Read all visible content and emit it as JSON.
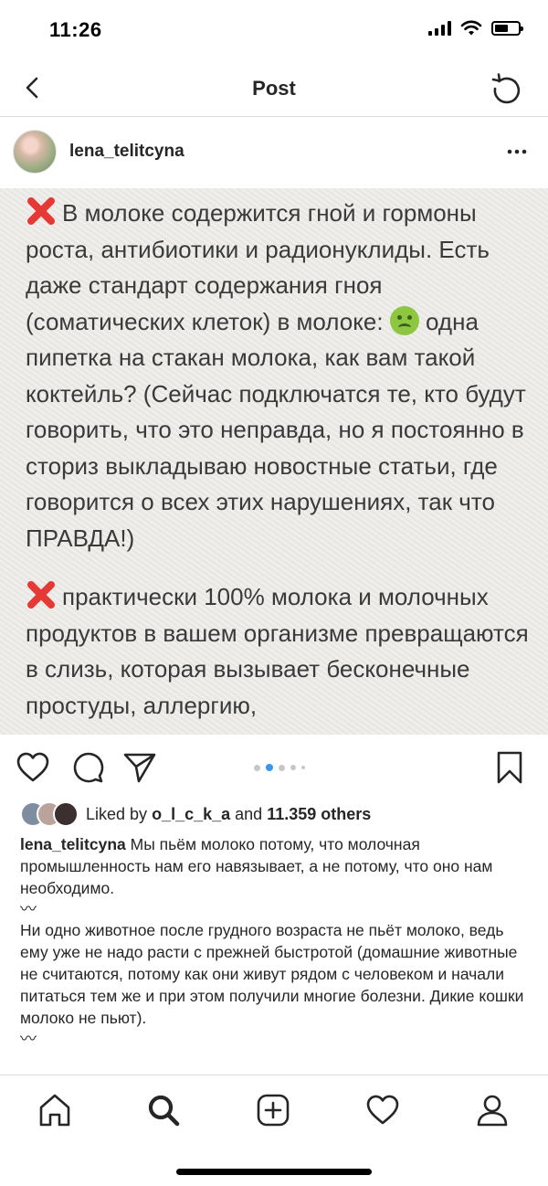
{
  "status_bar": {
    "time": "11:26"
  },
  "nav": {
    "title": "Post"
  },
  "post": {
    "username": "lena_telitcyna",
    "image_text": {
      "p1_text": "В молоке содержится гной и гормоны роста, антибиотики и радионуклиды. Есть даже стандарт содержания гноя (соматических клеток) в молоке: ",
      "p1_text_after_emoji": " одна пипетка на стакан молока, как вам такой коктейль? (Сейчас подключатся те, кто будут говорить, что это неправда, но я постоянно в сториз выкладываю новостные статьи, где говорится о всех этих нарушениях, так что ПРАВДА!)",
      "p2_text": "практически 100% молока и молочных продуктов в вашем организме превращаются в слизь, которая вызывает бесконечные простуды, аллергию,"
    },
    "carousel": {
      "count": 5,
      "active": 1
    },
    "likes": {
      "prefix": "Liked by",
      "user": "o_l_c_k_a",
      "joiner": "and",
      "others": "11.359 others"
    },
    "caption": {
      "username": "lena_telitcyna",
      "text1": " Мы пьём молоко потому, что молочная промышленность нам его навязывает, а не потому, что оно нам необходимо.",
      "separator": "〰",
      "text2": "Ни одно животное после грудного возраста не пьёт молоко, ведь ему уже не надо расти с прежней быстротой (домашние животные не считаются, потому как они живут рядом с человеком и начали питаться тем же и при этом получили многие болезни. Дикие кошки молоко не пьют)."
    }
  },
  "icons": {
    "back": "chevron-left-icon",
    "refresh": "refresh-icon",
    "more": "more-horizontal-icon",
    "cross": "cross-mark-icon",
    "emoji": "nauseated-face-icon",
    "like": "heart-icon",
    "comment": "comment-icon",
    "share": "paper-plane-icon",
    "save": "bookmark-icon",
    "tabs": [
      "home-icon",
      "search-icon",
      "add-post-icon",
      "activity-heart-icon",
      "profile-icon"
    ]
  },
  "colors": {
    "cross": "#e53935",
    "carousel_active": "#3897f0",
    "text": "#262626"
  }
}
